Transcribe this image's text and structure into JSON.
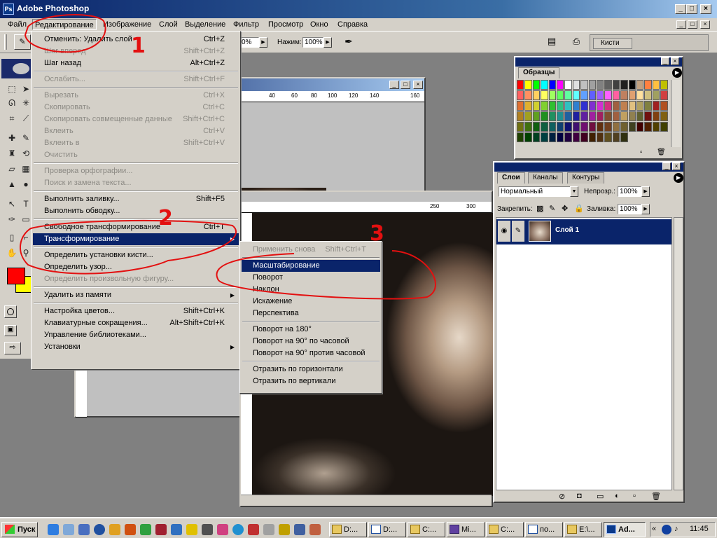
{
  "window": {
    "title": "Adobe Photoshop"
  },
  "menubar": [
    "Файл",
    "Редактирование",
    "Изображение",
    "Слой",
    "Выделение",
    "Фильтр",
    "Просмотр",
    "Окно",
    "Справка"
  ],
  "options": {
    "zoom_value": "0%",
    "pressure_label": "Нажим:",
    "pressure_value": "100%",
    "brushes_tab": "Кисти"
  },
  "edit_menu": [
    {
      "label": "Отменить: Удалить слой",
      "shortcut": "Ctrl+Z",
      "disabled": false
    },
    {
      "label": "Шаг вперед",
      "shortcut": "Shift+Ctrl+Z",
      "disabled": true
    },
    {
      "label": "Шаг назад",
      "shortcut": "Alt+Ctrl+Z",
      "disabled": false
    },
    {
      "sep": true
    },
    {
      "label": "Ослабить...",
      "shortcut": "Shift+Ctrl+F",
      "disabled": true
    },
    {
      "sep": true
    },
    {
      "label": "Вырезать",
      "shortcut": "Ctrl+X",
      "disabled": true
    },
    {
      "label": "Скопировать",
      "shortcut": "Ctrl+C",
      "disabled": true
    },
    {
      "label": "Скопировать совмещенные данные",
      "shortcut": "Shift+Ctrl+C",
      "disabled": true
    },
    {
      "label": "Вклеить",
      "shortcut": "Ctrl+V",
      "disabled": true
    },
    {
      "label": "Вклеить в",
      "shortcut": "Shift+Ctrl+V",
      "disabled": true
    },
    {
      "label": "Очистить",
      "shortcut": "",
      "disabled": true
    },
    {
      "sep": true
    },
    {
      "label": "Проверка орфографии...",
      "shortcut": "",
      "disabled": true
    },
    {
      "label": "Поиск и замена текста...",
      "shortcut": "",
      "disabled": true
    },
    {
      "sep": true
    },
    {
      "label": "Выполнить заливку...",
      "shortcut": "Shift+F5",
      "disabled": false
    },
    {
      "label": "Выполнить обводку...",
      "shortcut": "",
      "disabled": false
    },
    {
      "sep": true
    },
    {
      "label": "Свободное трансформирование",
      "shortcut": "Ctrl+T",
      "disabled": false
    },
    {
      "label": "Трансформирование",
      "shortcut": "",
      "disabled": false,
      "submenu": true,
      "highlighted": true
    },
    {
      "sep": true
    },
    {
      "label": "Определить установки кисти...",
      "shortcut": "",
      "disabled": false
    },
    {
      "label": "Определить узор...",
      "shortcut": "",
      "disabled": false
    },
    {
      "label": "Определить произвольную фигуру...",
      "shortcut": "",
      "disabled": true
    },
    {
      "sep": true
    },
    {
      "label": "Удалить из памяти",
      "shortcut": "",
      "disabled": false,
      "submenu": true
    },
    {
      "sep": true
    },
    {
      "label": "Настройка цветов...",
      "shortcut": "Shift+Ctrl+K",
      "disabled": false
    },
    {
      "label": "Клавиатурные сокращения...",
      "shortcut": "Alt+Shift+Ctrl+K",
      "disabled": false
    },
    {
      "label": "Управление библиотеками...",
      "shortcut": "",
      "disabled": false
    },
    {
      "label": "Установки",
      "shortcut": "",
      "disabled": false,
      "submenu": true
    }
  ],
  "transform_menu": [
    {
      "label": "Применить снова",
      "shortcut": "Shift+Ctrl+T",
      "disabled": true
    },
    {
      "sep": true
    },
    {
      "label": "Масштабирование",
      "shortcut": "",
      "disabled": false,
      "highlighted": true
    },
    {
      "label": "Поворот",
      "shortcut": "",
      "disabled": false
    },
    {
      "label": "Наклон",
      "shortcut": "",
      "disabled": false
    },
    {
      "label": "Искажение",
      "shortcut": "",
      "disabled": false
    },
    {
      "label": "Перспектива",
      "shortcut": "",
      "disabled": false
    },
    {
      "sep": true
    },
    {
      "label": "Поворот на 180°",
      "shortcut": "",
      "disabled": false
    },
    {
      "label": "Поворот на 90° по часовой",
      "shortcut": "",
      "disabled": false
    },
    {
      "label": "Поворот на 90° против часовой",
      "shortcut": "",
      "disabled": false
    },
    {
      "sep": true
    },
    {
      "label": "Отразить по горизонтали",
      "shortcut": "",
      "disabled": false
    },
    {
      "label": "Отразить по вертикали",
      "shortcut": "",
      "disabled": false
    }
  ],
  "doc_ruler_ticks": [
    "40",
    "60",
    "80",
    "100",
    "120",
    "140",
    "160"
  ],
  "photo_ruler_ticks": [
    "250",
    "300"
  ],
  "swatches_panel": {
    "tab": "Образцы"
  },
  "swatch_colors": [
    "#ff0000",
    "#ffff00",
    "#00ff00",
    "#00ffff",
    "#0000ff",
    "#ff00ff",
    "#ffffff",
    "#e0e0e0",
    "#c0c0c0",
    "#a0a0a0",
    "#808080",
    "#606060",
    "#404040",
    "#202020",
    "#000000",
    "#c0a080",
    "#ff8040",
    "#ffc040",
    "#c0c000",
    "#ff6060",
    "#ff9060",
    "#ffd060",
    "#ffff60",
    "#a0ff60",
    "#60ff60",
    "#60ffa0",
    "#60ffff",
    "#60a0ff",
    "#6060ff",
    "#a060ff",
    "#ff60ff",
    "#ff60a0",
    "#c08060",
    "#e0a070",
    "#ffe0a0",
    "#d0c080",
    "#a0a060",
    "#d04040",
    "#e07030",
    "#e0b030",
    "#d0d030",
    "#80d030",
    "#30c030",
    "#30c080",
    "#30c0c0",
    "#3080d0",
    "#3030d0",
    "#8030d0",
    "#d030d0",
    "#d03080",
    "#a06040",
    "#c08050",
    "#e0c080",
    "#b0a060",
    "#808040",
    "#a02020",
    "#b05020",
    "#b08020",
    "#a0a020",
    "#60a020",
    "#209020",
    "#209060",
    "#209090",
    "#2060a0",
    "#2020a0",
    "#6020a0",
    "#a020a0",
    "#a02060",
    "#805030",
    "#a06040",
    "#c0a060",
    "#908050",
    "#606030",
    "#701010",
    "#804010",
    "#806010",
    "#707010",
    "#407010",
    "#106010",
    "#106040",
    "#106060",
    "#104070",
    "#101070",
    "#401070",
    "#701070",
    "#701040",
    "#603010",
    "#704020",
    "#907040",
    "#706030",
    "#404020",
    "#400000",
    "#502000",
    "#504000",
    "#404000",
    "#204000",
    "#004000",
    "#004020",
    "#004040",
    "#002040",
    "#000040",
    "#200040",
    "#400040",
    "#400020",
    "#402000",
    "#503010",
    "#605020",
    "#504020",
    "#303010"
  ],
  "layers_panel": {
    "tabs": [
      "Слои",
      "Каналы",
      "Контуры"
    ],
    "blend_mode": "Нормальный",
    "opacity_label": "Непрозр.:",
    "opacity_value": "100%",
    "lock_label": "Закрепить:",
    "fill_label": "Заливка:",
    "fill_value": "100%",
    "layer_name": "Слой 1"
  },
  "annotations": [
    "1",
    "2",
    "3"
  ],
  "taskbar": {
    "start": "Пуск",
    "buttons": [
      "D:...",
      "D:...",
      "C:...",
      "Mi...",
      "C:...",
      "по...",
      "E:\\...",
      "Ad..."
    ],
    "clock": "11:45"
  }
}
